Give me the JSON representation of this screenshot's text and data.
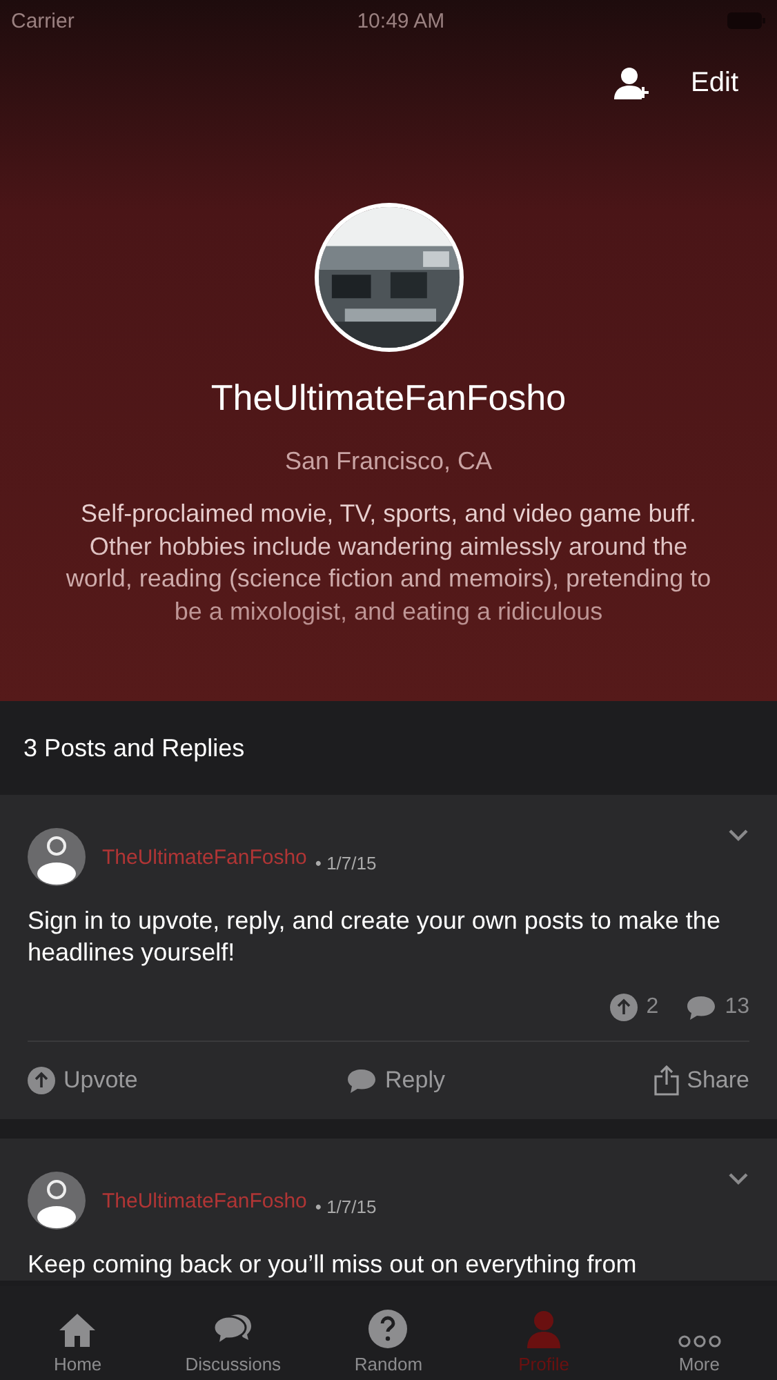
{
  "status_bar": {
    "carrier": "Carrier",
    "time": "10:49 AM"
  },
  "header": {
    "edit": "Edit",
    "username": "TheUltimateFanFosho",
    "location": "San Francisco, CA",
    "bio": "Self-proclaimed movie, TV, sports, and video game buff. Other hobbies include wandering aimlessly around the world, reading (science fiction and memoirs), pretending to be a mixologist, and eating a ridiculous"
  },
  "section_title": "3 Posts and Replies",
  "posts": [
    {
      "author": "TheUltimateFanFosho",
      "date": "• 1/7/15",
      "body": "Sign in to upvote, reply, and create your own posts to make the headlines yourself!",
      "upvotes": "2",
      "comments": "13",
      "actions": {
        "upvote": "Upvote",
        "reply": "Reply",
        "share": "Share"
      }
    },
    {
      "author": "TheUltimateFanFosho",
      "date": "• 1/7/15",
      "body": "Keep coming back or you’ll miss out on everything from"
    }
  ],
  "tabs": [
    {
      "kind": "home",
      "label": "Home",
      "selected": false
    },
    {
      "kind": "discussions",
      "label": "Discussions",
      "selected": false
    },
    {
      "kind": "random",
      "label": "Random",
      "selected": false
    },
    {
      "kind": "profile",
      "label": "Profile",
      "selected": true
    },
    {
      "kind": "more",
      "label": "More",
      "selected": false
    }
  ]
}
